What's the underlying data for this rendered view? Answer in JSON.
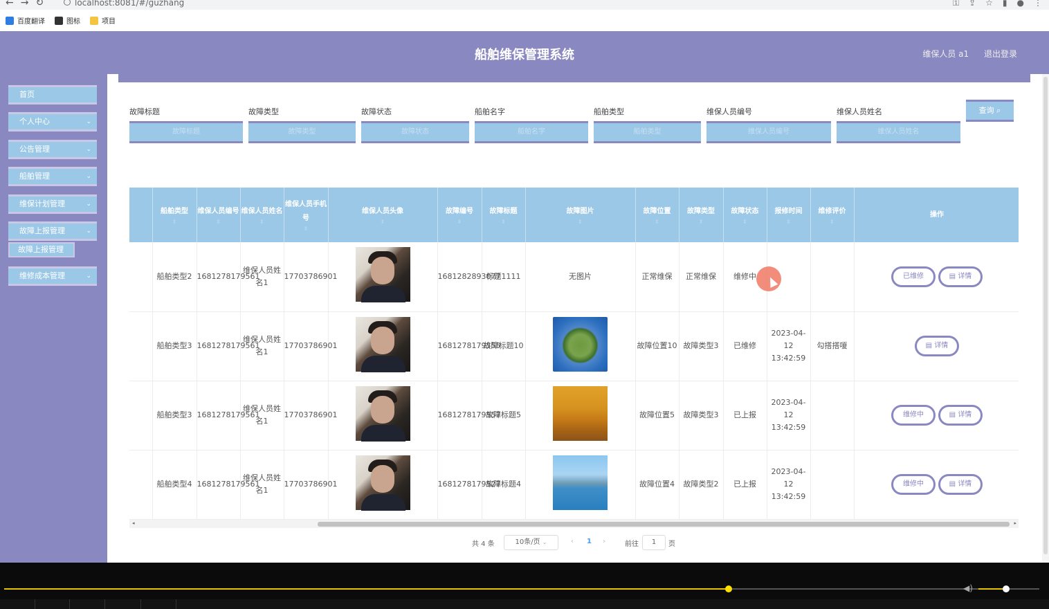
{
  "browser": {
    "url": "localhost:8081/#/guzhang",
    "bookmarks": [
      {
        "label": "百度翻译",
        "color": "#2f7de1"
      },
      {
        "label": "图标",
        "color": "#333333"
      },
      {
        "label": "项目",
        "color": "#f4c542"
      }
    ]
  },
  "header": {
    "title": "船舶维保管理系统",
    "user": "维保人员 a1",
    "logout": "退出登录"
  },
  "sidebar": {
    "items": [
      {
        "label": "首页",
        "has_chevron": false
      },
      {
        "label": "个人中心",
        "has_chevron": true
      },
      {
        "label": "公告管理",
        "has_chevron": true
      },
      {
        "label": "船舶管理",
        "has_chevron": true
      },
      {
        "label": "维保计划管理",
        "has_chevron": true
      },
      {
        "label": "故障上报管理",
        "has_chevron": true
      }
    ],
    "active_sub": "故障上报管理",
    "last": "维修成本管理"
  },
  "search": {
    "fields": [
      {
        "label": "故障标题",
        "placeholder": "故障标题"
      },
      {
        "label": "故障类型",
        "placeholder": "故障类型"
      },
      {
        "label": "故障状态",
        "placeholder": "故障状态"
      },
      {
        "label": "船舶名字",
        "placeholder": "船舶名字"
      },
      {
        "label": "船舶类型",
        "placeholder": "船舶类型"
      },
      {
        "label": "维保人员编号",
        "placeholder": "维保人员编号"
      },
      {
        "label": "维保人员姓名",
        "placeholder": "维保人员姓名"
      }
    ],
    "query_button": "查询",
    "query_icon": "search-icon"
  },
  "table": {
    "columns": [
      "船舶类型",
      "维保人员编号",
      "维保人员姓名",
      "维保人员手机号",
      "维保人员头像",
      "故障编号",
      "故障标题",
      "故障图片",
      "故障位置",
      "故障类型",
      "故障状态",
      "报修时间",
      "维修评价",
      "操作"
    ],
    "rows": [
      {
        "ship_type": "船舶类型2",
        "staff_no": "1681278179561",
        "staff_name": "维保人员姓名1",
        "phone": "17703786901",
        "fault_no": "1681282893077",
        "fault_title": "标题1111",
        "image": "无图片",
        "location": "正常维保",
        "fault_type": "正常维保",
        "status": "维修中",
        "time": "",
        "review": "",
        "actions": [
          "已维修",
          "详情"
        ]
      },
      {
        "ship_type": "船舶类型3",
        "staff_no": "1681278179561",
        "staff_name": "维保人员姓名1",
        "phone": "17703786901",
        "fault_no": "1681278179555",
        "fault_title": "故障标题10",
        "image": "globe",
        "location": "故障位置10",
        "fault_type": "故障类型3",
        "status": "已维修",
        "time": "2023-04-12 13:42:59",
        "review": "勾搭搭嗄",
        "actions": [
          "详情"
        ]
      },
      {
        "ship_type": "船舶类型3",
        "staff_no": "1681278179561",
        "staff_name": "维保人员姓名1",
        "phone": "17703786901",
        "fault_no": "1681278179557",
        "fault_title": "故障标题5",
        "image": "autumn",
        "location": "故障位置5",
        "fault_type": "故障类型3",
        "status": "已上报",
        "time": "2023-04-12 13:42:59",
        "review": "",
        "actions": [
          "维修中",
          "详情"
        ]
      },
      {
        "ship_type": "船舶类型4",
        "staff_no": "1681278179561",
        "staff_name": "维保人员姓名1",
        "phone": "17703786901",
        "fault_no": "1681278179527",
        "fault_title": "故障标题4",
        "image": "lake",
        "location": "故障位置4",
        "fault_type": "故障类型2",
        "status": "已上报",
        "time": "2023-04-12 13:42:59",
        "review": "",
        "actions": [
          "维修中",
          "详情"
        ]
      }
    ]
  },
  "pager": {
    "total": "共 4 条",
    "page_size": "10条/页",
    "current": "1",
    "goto_label": "前往",
    "goto_value": "1",
    "page_suffix": "页"
  },
  "video": {
    "progress": 0.7,
    "volume": 0.45
  },
  "colors": {
    "purple": "#8a88c0",
    "blue": "#9cc8e8"
  }
}
